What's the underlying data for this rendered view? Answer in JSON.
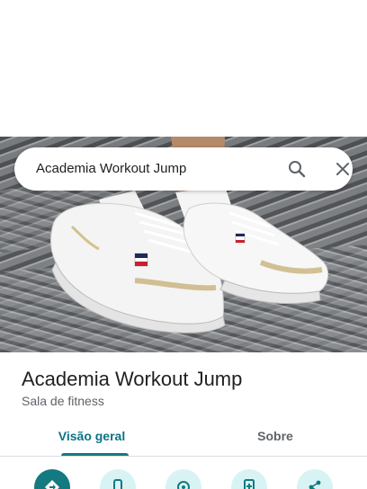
{
  "search": {
    "value": "Academia Workout Jump",
    "search_icon": "search-icon",
    "clear_icon": "close-icon"
  },
  "hero": {
    "image": "photo of white sneakers on tiled pavement"
  },
  "place": {
    "title": "Academia Workout Jump",
    "category": "Sala de fitness"
  },
  "tabs": [
    {
      "label": "Visão geral",
      "selected": true
    },
    {
      "label": "Sobre",
      "selected": false
    }
  ],
  "actions": [
    {
      "icon": "directions-icon"
    },
    {
      "icon": "phone-icon"
    },
    {
      "icon": "location-icon"
    },
    {
      "icon": "save-icon"
    },
    {
      "icon": "share-icon"
    }
  ],
  "colors": {
    "accent": "#137a7f",
    "accent_light": "#d8f3f4",
    "text_primary": "#202124",
    "text_secondary": "#5f6368"
  }
}
